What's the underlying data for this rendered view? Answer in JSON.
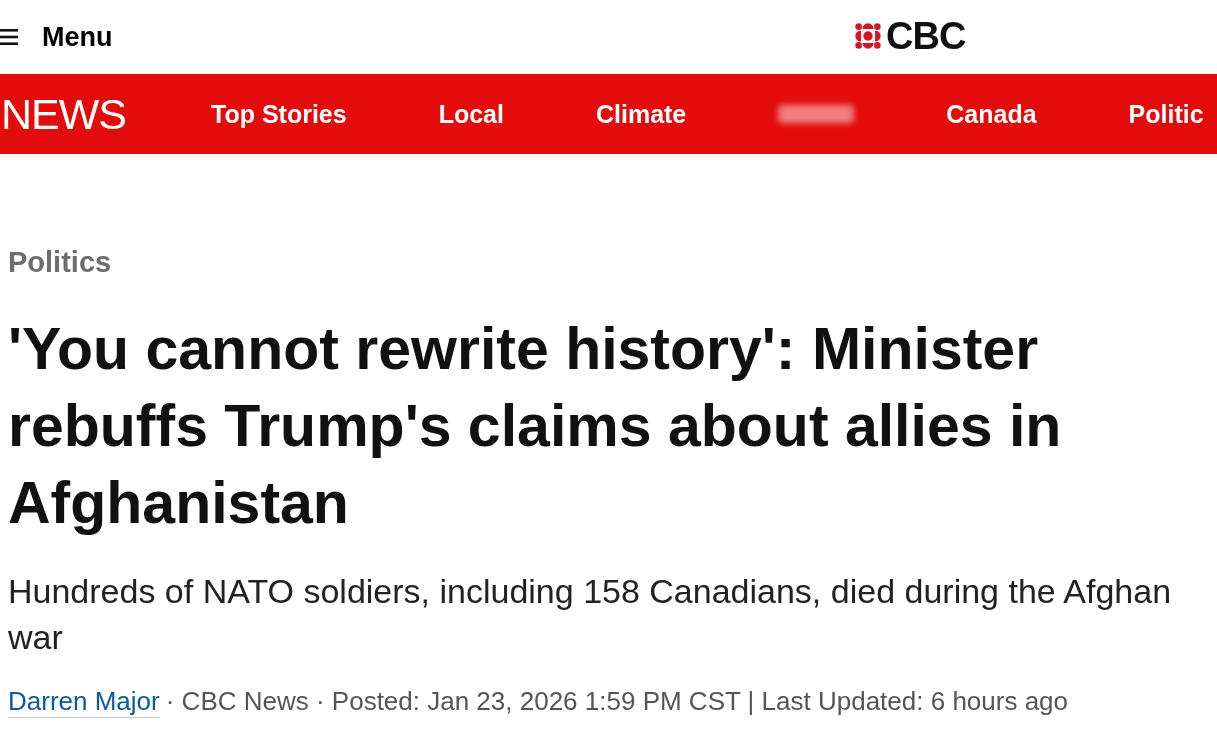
{
  "header": {
    "menu_label": "Menu",
    "logo_text": "CBC"
  },
  "news_bar": {
    "brand": "NEWS",
    "nav_items": [
      {
        "kind": "link",
        "label": "Top Stories"
      },
      {
        "kind": "link",
        "label": "Local"
      },
      {
        "kind": "link",
        "label": "Climate"
      },
      {
        "kind": "blurred"
      },
      {
        "kind": "link",
        "label": "Canada"
      },
      {
        "kind": "link",
        "label": "Politic"
      }
    ]
  },
  "article": {
    "section": "Politics",
    "headline": "'You cannot rewrite history': Minister rebuffs Trump's claims about allies in Afghanistan",
    "dek": "Hundreds of NATO soldiers, including 158 Canadians, died during the Afghan war",
    "byline": {
      "author": "Darren Major",
      "meta": "· CBC News · Posted: Jan 23, 2026 1:59 PM CST | Last Updated: 6 hours ago"
    }
  }
}
